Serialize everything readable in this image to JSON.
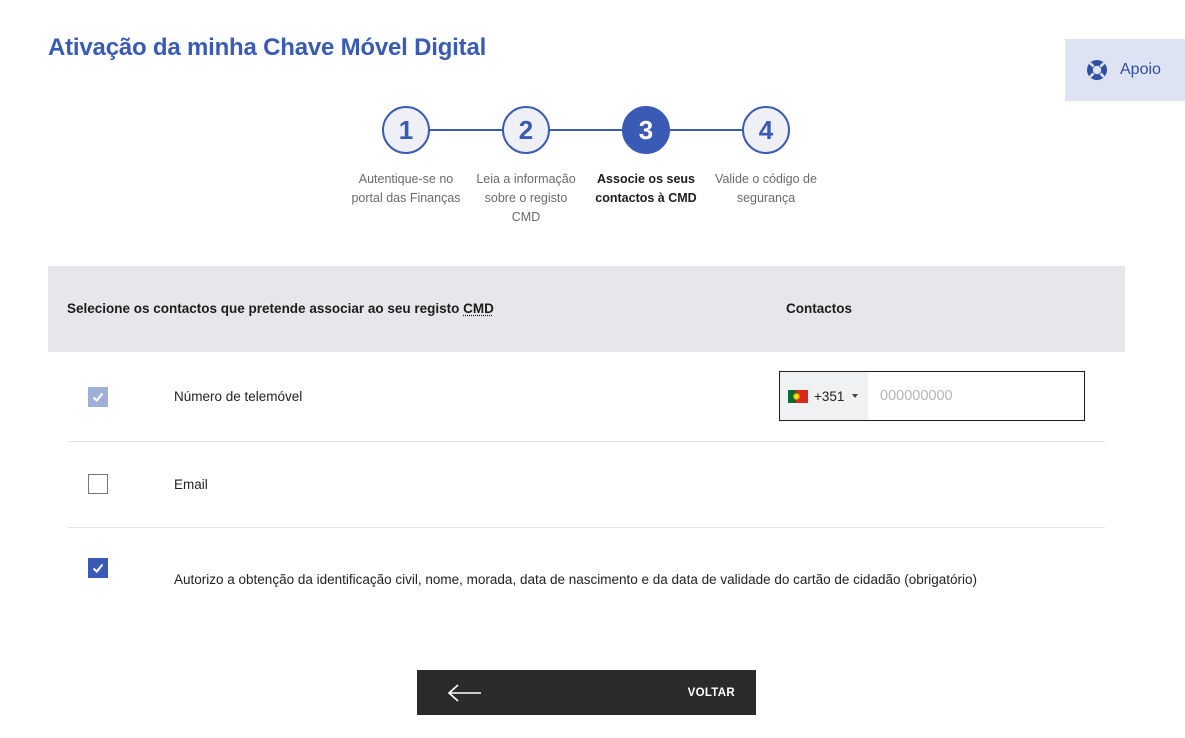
{
  "page": {
    "title": "Ativação da minha Chave Móvel Digital"
  },
  "support": {
    "label": "Apoio",
    "icon": "lifebuoy-icon"
  },
  "stepper": {
    "steps": [
      {
        "number": "1",
        "label": "Autentique-se no portal das Finanças",
        "active": false
      },
      {
        "number": "2",
        "label": "Leia a informação sobre o registo CMD",
        "active": false
      },
      {
        "number": "3",
        "label": "Associe os seus contactos à CMD",
        "active": true
      },
      {
        "number": "4",
        "label": "Valide o código de segurança",
        "active": false
      }
    ]
  },
  "table": {
    "header_left_prefix": "Selecione os contactos que pretende associar ao seu registo ",
    "header_left_abbr": "CMD",
    "header_right": "Contactos",
    "rows": [
      {
        "label": "Número de telemóvel",
        "checked": true,
        "disabled": true
      },
      {
        "label": "Email",
        "checked": false,
        "disabled": false
      },
      {
        "label": "Autorizo a obtenção da identificação civil, nome, morada, data de nascimento e da data de validade do cartão de cidadão (obrigatório)",
        "checked": true,
        "disabled": false
      }
    ]
  },
  "phone": {
    "dial_code": "+351",
    "country_flag": "portugal-flag-icon",
    "placeholder": "000000000",
    "value": ""
  },
  "back_button": {
    "label": "VOLTAR",
    "icon": "arrow-left-icon"
  },
  "colors": {
    "primary": "#3a5bb5",
    "header_bg": "#e6e7ea",
    "support_bg": "#dde3f3",
    "button_bg": "#2b2b2b"
  }
}
